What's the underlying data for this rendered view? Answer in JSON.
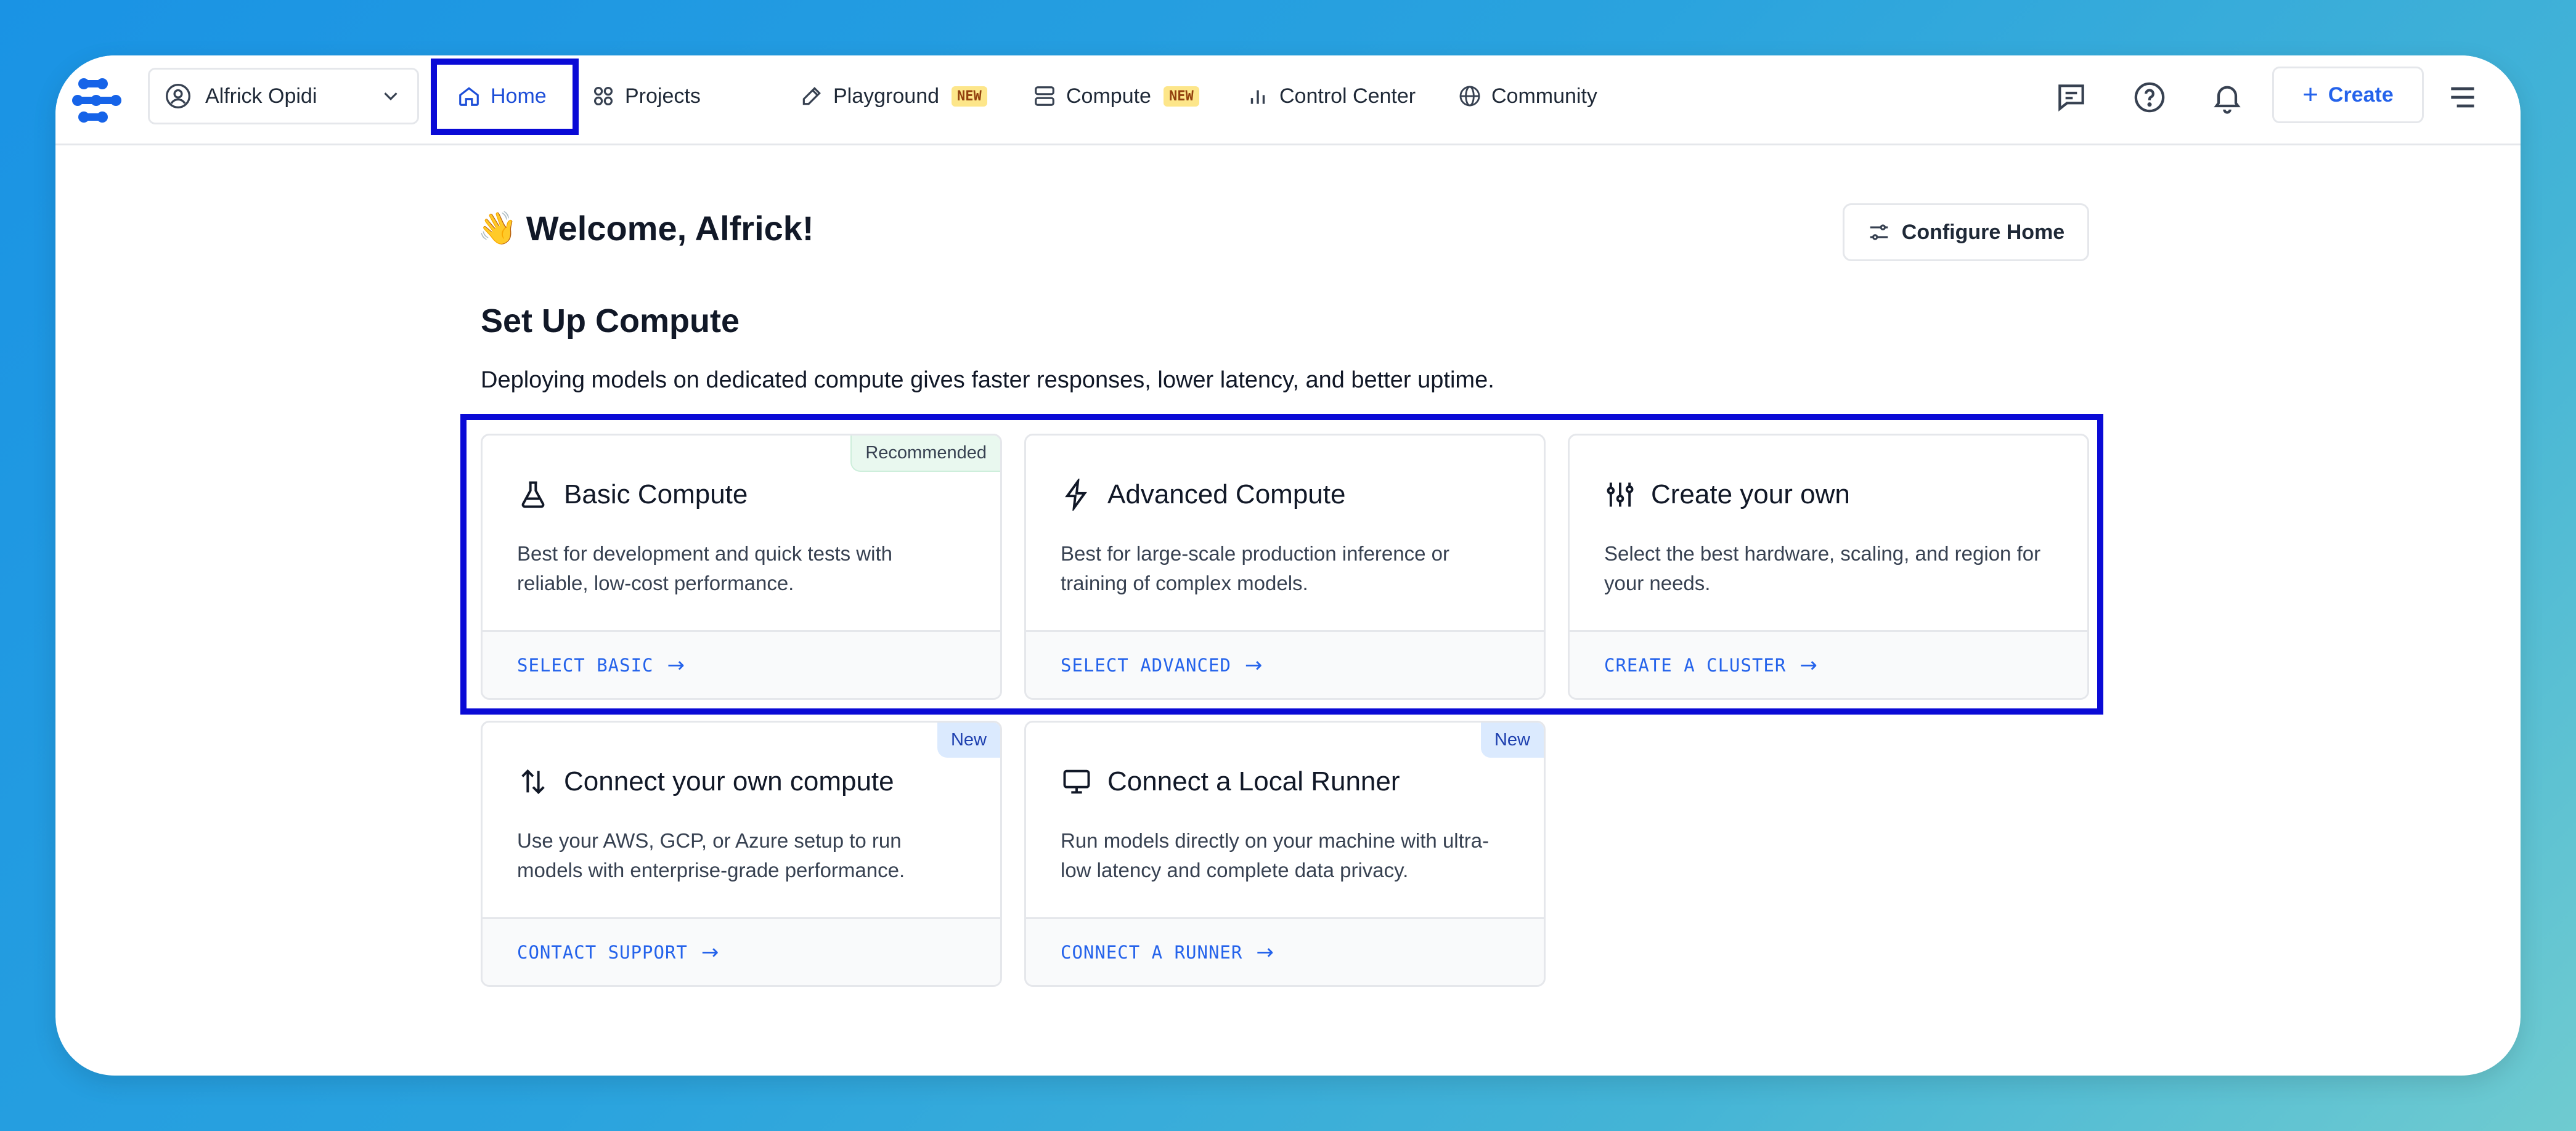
{
  "colors": {
    "accent": "#2563eb",
    "highlight": "#0a0ad6",
    "new_badge_bg": "#fde68a",
    "recommended_bg": "#e9f8ef",
    "new_tag_bg": "#dbeafe"
  },
  "nav": {
    "logo_icon": "clarifai-logo-icon",
    "org": {
      "name": "Alfrick Opidi",
      "icon": "user-circle-icon",
      "chevron": "chevron-down-icon"
    },
    "items": [
      {
        "label": "Home",
        "icon": "home-icon",
        "active": true,
        "badge": ""
      },
      {
        "label": "Projects",
        "icon": "grid-icon",
        "active": false,
        "badge": ""
      },
      {
        "label": "Playground",
        "icon": "pencil-icon",
        "active": false,
        "badge": "NEW"
      },
      {
        "label": "Compute",
        "icon": "server-icon",
        "active": false,
        "badge": "NEW"
      },
      {
        "label": "Control Center",
        "icon": "bar-chart-icon",
        "active": false,
        "badge": ""
      },
      {
        "label": "Community",
        "icon": "globe-icon",
        "active": false,
        "badge": ""
      }
    ],
    "right_icons": [
      "chat-icon",
      "help-circle-icon",
      "bell-icon",
      "menu-icon"
    ],
    "create_label": "Create"
  },
  "main": {
    "welcome_emoji": "👋",
    "welcome_text": "Welcome, Alfrick!",
    "configure_label": "Configure Home",
    "section_title": "Set Up Compute",
    "section_desc": "Deploying models on dedicated compute gives faster responses, lower latency, and better uptime.",
    "cards": [
      {
        "title": "Basic Compute",
        "icon": "flask-icon",
        "desc": "Best for development and quick tests with reliable, low-cost performance.",
        "action": "SELECT BASIC",
        "tag": "Recommended"
      },
      {
        "title": "Advanced Compute",
        "icon": "lightning-icon",
        "desc": "Best for large-scale production inference or training of complex models.",
        "action": "SELECT ADVANCED",
        "tag": ""
      },
      {
        "title": "Create your own",
        "icon": "sliders-icon",
        "desc": "Select the best hardware, scaling, and region for your needs.",
        "action": "CREATE A CLUSTER",
        "tag": ""
      },
      {
        "title": "Connect your own compute",
        "icon": "swap-vertical-icon",
        "desc": "Use your AWS, GCP, or Azure setup to run models with enterprise-grade performance.",
        "action": "CONTACT SUPPORT",
        "tag": "New"
      },
      {
        "title": "Connect a Local Runner",
        "icon": "monitor-icon",
        "desc": "Run models directly on your machine with ultra-low latency and complete data privacy.",
        "action": "CONNECT A RUNNER",
        "tag": "New"
      }
    ]
  }
}
